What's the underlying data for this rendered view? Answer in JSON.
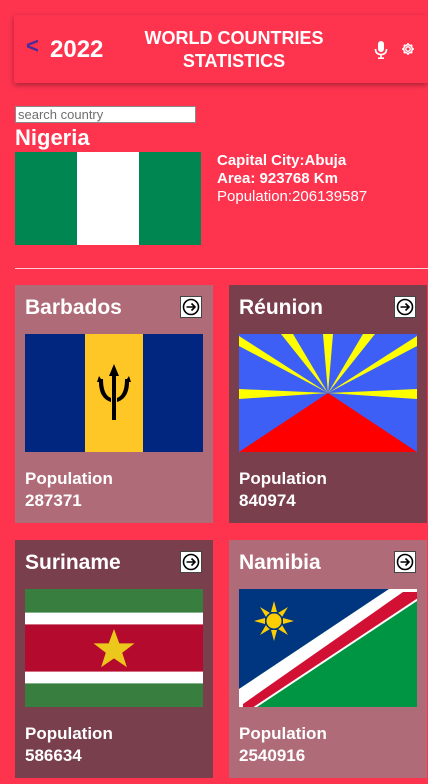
{
  "header": {
    "back_symbol": "<",
    "year": "2022",
    "title_line1": "WORLD COUNTRIES",
    "title_line2": "STATISTICS",
    "icons": [
      "microphone-icon",
      "gear-icon"
    ]
  },
  "search": {
    "placeholder": "search country",
    "value": ""
  },
  "selected": {
    "name": "Nigeria",
    "capital": "Capital City:Abuja",
    "area": "Area: 923768 Km",
    "population": "Population:206139587"
  },
  "cards": [
    {
      "name": "Barbados",
      "population_label": "Population",
      "population": "287371"
    },
    {
      "name": "Réunion",
      "population_label": "Population",
      "population": "840974"
    },
    {
      "name": "Suriname",
      "population_label": "Population",
      "population": "586634"
    },
    {
      "name": "Namibia",
      "population_label": "Population",
      "population": "2540916"
    }
  ],
  "colors": {
    "background": "#fe344f",
    "card_light": "#b06b78",
    "card_dark": "#7a3f4c",
    "back_arrow": "#4b2a9a"
  }
}
